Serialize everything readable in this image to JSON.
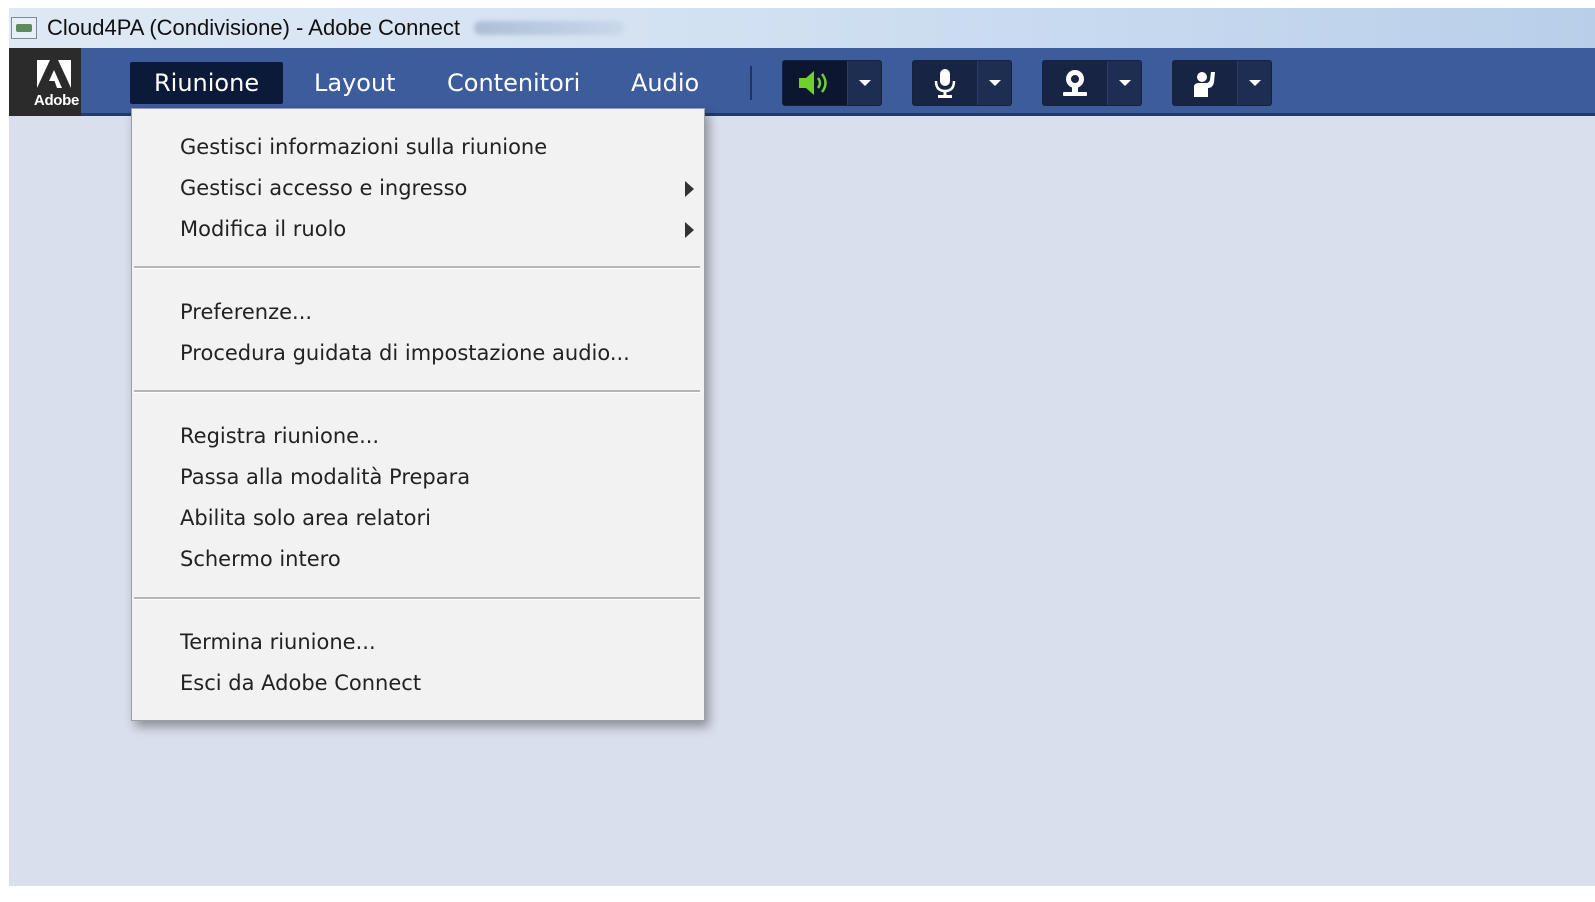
{
  "window": {
    "title": "Cloud4PA (Condivisione) - Adobe Connect"
  },
  "brand": {
    "logo_text": "Adobe"
  },
  "menubar": {
    "tabs": [
      {
        "label": "Riunione",
        "active": true
      },
      {
        "label": "Layout"
      },
      {
        "label": "Contenitori"
      },
      {
        "label": "Audio"
      }
    ]
  },
  "controls": {
    "speaker": {
      "icon": "speaker-icon",
      "state": "on",
      "color": "#6fd12a"
    },
    "microphone": {
      "icon": "microphone-icon"
    },
    "webcam": {
      "icon": "webcam-icon"
    },
    "status": {
      "icon": "raise-hand-icon"
    }
  },
  "meeting_menu": {
    "groups": [
      [
        {
          "label": "Gestisci informazioni sulla riunione"
        },
        {
          "label": "Gestisci accesso e ingresso",
          "submenu": true
        },
        {
          "label": "Modifica il ruolo",
          "submenu": true
        }
      ],
      [
        {
          "label": "Preferenze..."
        },
        {
          "label": "Procedura guidata di impostazione audio..."
        }
      ],
      [
        {
          "label": "Registra riunione..."
        },
        {
          "label": "Passa alla modalità Prepara"
        },
        {
          "label": "Abilita solo area relatori"
        },
        {
          "label": "Schermo intero"
        }
      ],
      [
        {
          "label": "Termina riunione..."
        },
        {
          "label": "Esci da Adobe Connect"
        }
      ]
    ]
  }
}
